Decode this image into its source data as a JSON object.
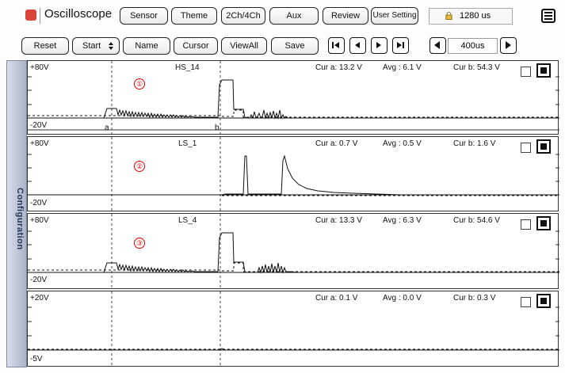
{
  "toolbar": {
    "title": "Oscilloscope",
    "sensor": "Sensor",
    "theme": "Theme",
    "channels": "2Ch/4Ch",
    "aux": "Aux",
    "review": "Review",
    "user_setting": "User Setting",
    "time_window": "1280 us"
  },
  "controls": {
    "reset": "Reset",
    "start": "Start",
    "name": "Name",
    "cursor": "Cursor",
    "view_all": "ViewAll",
    "save": "Save",
    "zoom": "400us"
  },
  "sidebar": {
    "label": "Configuration"
  },
  "cursors": {
    "a": "a",
    "b": "b"
  },
  "channels": [
    {
      "number": "①",
      "name": "HS_14",
      "ymax": "+80V",
      "ymin": "-20V",
      "cur_a": "Cur a: 13.2 V",
      "avg": "Avg : 6.1 V",
      "cur_b": "Cur b: 54.3 V"
    },
    {
      "number": "②",
      "name": "LS_1",
      "ymax": "+80V",
      "ymin": "-20V",
      "cur_a": "Cur a: 0.7 V",
      "avg": "Avg : 0.5 V",
      "cur_b": "Cur b: 1.6 V"
    },
    {
      "number": "③",
      "name": "LS_4",
      "ymax": "+80V",
      "ymin": "-20V",
      "cur_a": "Cur a: 13.3 V",
      "avg": "Avg : 6.3 V",
      "cur_b": "Cur b: 54.6 V"
    },
    {
      "number": "",
      "name": "",
      "ymax": "+20V",
      "ymin": "-5V",
      "cur_a": "Cur a: 0.1 V",
      "avg": "Avg : 0.0 V",
      "cur_b": "Cur b: 0.3 V"
    }
  ],
  "colors": {
    "logo": "#d9453a",
    "marker": "#e00000",
    "sidebar": "#aab4c9"
  },
  "icons": [
    "logo-icon",
    "lock-icon",
    "menu-icon",
    "skip-first-icon",
    "step-back-icon",
    "step-forward-icon",
    "skip-last-icon",
    "zoom-out-icon",
    "zoom-in-icon"
  ]
}
